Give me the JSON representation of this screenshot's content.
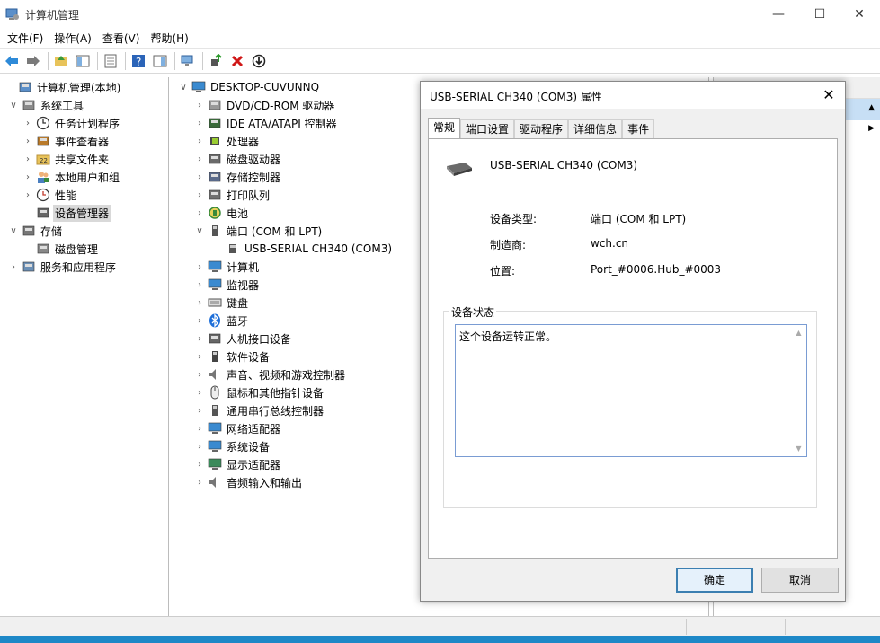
{
  "window": {
    "title": "计算机管理"
  },
  "menu": [
    "文件(F)",
    "操作(A)",
    "查看(V)",
    "帮助(H)"
  ],
  "left_tree": [
    {
      "label": "计算机管理(本地)",
      "icon": "computer-management-icon",
      "level": 0,
      "expander": ""
    },
    {
      "label": "系统工具",
      "icon": "tools-icon",
      "level": 1,
      "expander": "∨"
    },
    {
      "label": "任务计划程序",
      "icon": "clock-icon",
      "level": 2,
      "expander": "›"
    },
    {
      "label": "事件查看器",
      "icon": "event-viewer-icon",
      "level": 2,
      "expander": "›"
    },
    {
      "label": "共享文件夹",
      "icon": "shared-folder-icon",
      "level": 2,
      "expander": "›"
    },
    {
      "label": "本地用户和组",
      "icon": "users-icon",
      "level": 2,
      "expander": "›"
    },
    {
      "label": "性能",
      "icon": "performance-icon",
      "level": 2,
      "expander": "›"
    },
    {
      "label": "设备管理器",
      "icon": "device-manager-icon",
      "level": 2,
      "expander": "",
      "selected": true
    },
    {
      "label": "存储",
      "icon": "storage-icon",
      "level": 1,
      "expander": "∨"
    },
    {
      "label": "磁盘管理",
      "icon": "disk-management-icon",
      "level": 2,
      "expander": ""
    },
    {
      "label": "服务和应用程序",
      "icon": "services-icon",
      "level": 1,
      "expander": "›"
    }
  ],
  "device_tree": {
    "root": "DESKTOP-CUVUNNQ",
    "items": [
      {
        "label": "DVD/CD-ROM 驱动器",
        "icon": "dvd-icon",
        "expander": "›"
      },
      {
        "label": "IDE ATA/ATAPI 控制器",
        "icon": "ide-controller-icon",
        "expander": "›"
      },
      {
        "label": "处理器",
        "icon": "processor-icon",
        "expander": "›"
      },
      {
        "label": "磁盘驱动器",
        "icon": "disk-drive-icon",
        "expander": "›"
      },
      {
        "label": "存储控制器",
        "icon": "storage-controller-icon",
        "expander": "›"
      },
      {
        "label": "打印队列",
        "icon": "printer-icon",
        "expander": "›"
      },
      {
        "label": "电池",
        "icon": "battery-icon",
        "expander": "›"
      },
      {
        "label": "端口 (COM 和 LPT)",
        "icon": "port-icon",
        "expander": "∨"
      },
      {
        "label": "USB-SERIAL CH340 (COM3)",
        "icon": "serial-port-icon",
        "expander": "",
        "child": true
      },
      {
        "label": "计算机",
        "icon": "computer-icon",
        "expander": "›"
      },
      {
        "label": "监视器",
        "icon": "monitor-icon",
        "expander": "›"
      },
      {
        "label": "键盘",
        "icon": "keyboard-icon",
        "expander": "›"
      },
      {
        "label": "蓝牙",
        "icon": "bluetooth-icon",
        "expander": "›"
      },
      {
        "label": "人机接口设备",
        "icon": "hid-icon",
        "expander": "›"
      },
      {
        "label": "软件设备",
        "icon": "software-device-icon",
        "expander": "›"
      },
      {
        "label": "声音、视频和游戏控制器",
        "icon": "sound-icon",
        "expander": "›"
      },
      {
        "label": "鼠标和其他指针设备",
        "icon": "mouse-icon",
        "expander": "›"
      },
      {
        "label": "通用串行总线控制器",
        "icon": "usb-icon",
        "expander": "›"
      },
      {
        "label": "网络适配器",
        "icon": "network-adapter-icon",
        "expander": "›"
      },
      {
        "label": "系统设备",
        "icon": "system-device-icon",
        "expander": "›"
      },
      {
        "label": "显示适配器",
        "icon": "display-adapter-icon",
        "expander": "›"
      },
      {
        "label": "音频输入和输出",
        "icon": "audio-io-icon",
        "expander": "›"
      }
    ]
  },
  "dialog": {
    "title": "USB-SERIAL CH340 (COM3) 属性",
    "tabs": [
      "常规",
      "端口设置",
      "驱动程序",
      "详细信息",
      "事件"
    ],
    "device_name": "USB-SERIAL CH340 (COM3)",
    "props": [
      {
        "label": "设备类型:",
        "value": "端口 (COM 和 LPT)"
      },
      {
        "label": "制造商:",
        "value": "wch.cn"
      },
      {
        "label": "位置:",
        "value": "Port_#0006.Hub_#0003"
      }
    ],
    "status_legend": "设备状态",
    "status_text": "这个设备运转正常。",
    "ok_label": "确定",
    "cancel_label": "取消"
  },
  "colors": {
    "selection": "#c7dff5",
    "default_button_border": "#3c7fb1",
    "taskbar": "#1e88c7"
  }
}
